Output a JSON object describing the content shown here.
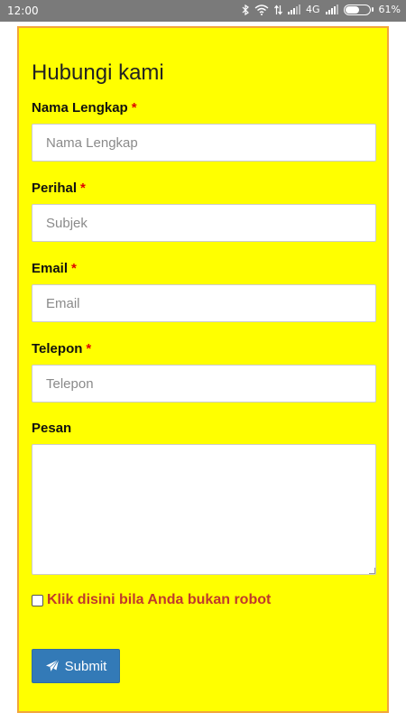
{
  "status_bar": {
    "time": "12:00",
    "network": "4G",
    "battery_percent": "61%",
    "battery_level": 0.61,
    "icons": [
      "bluetooth-icon",
      "wifi-icon",
      "data-arrows-icon",
      "signal-icon",
      "signal-icon",
      "battery-icon"
    ]
  },
  "form": {
    "title": "Hubungi kami",
    "required_marker": "*",
    "fields": [
      {
        "label": "Nama Lengkap",
        "placeholder": "Nama Lengkap",
        "value": ""
      },
      {
        "label": "Perihal",
        "placeholder": "Subjek",
        "value": ""
      },
      {
        "label": "Email",
        "placeholder": "Email",
        "value": ""
      },
      {
        "label": "Telepon",
        "placeholder": "Telepon",
        "value": ""
      }
    ],
    "message": {
      "label": "Pesan",
      "value": ""
    },
    "captcha": {
      "label": "Klik disini bila Anda bukan robot",
      "checked": false
    },
    "submit_label": "Submit",
    "colors": {
      "card_background": "#ffff00",
      "card_border": "#f2a63a",
      "required": "#e00000",
      "captcha_text": "#c0392b",
      "submit_button": "#337ab7"
    }
  }
}
